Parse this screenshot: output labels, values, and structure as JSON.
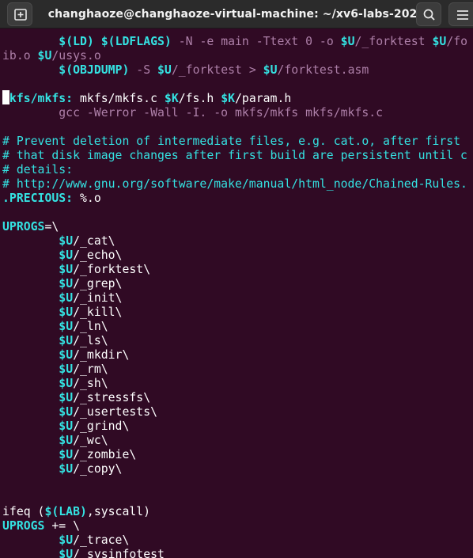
{
  "window": {
    "title": "changhaoze@changhaoze-virtual-machine: ~/xv6-labs-2020",
    "new_tab_icon": "new-tab-icon",
    "search_icon": "search-icon",
    "menu_icon": "hamburger-menu-icon"
  },
  "colors": {
    "terminal_bg": "#300a24",
    "titlebar_bg": "#2b2b2b",
    "cyan": "#34e2e2",
    "recipe": "#ad7fa8",
    "plain": "#ffffff"
  },
  "lines": [
    [
      {
        "t": "        ",
        "k": "p"
      },
      {
        "t": "$(LD)",
        "k": "v"
      },
      {
        "t": " ",
        "k": "p"
      },
      {
        "t": "$(LDFLAGS)",
        "k": "v"
      },
      {
        "t": " -N -e main -Ttext 0 -o ",
        "k": "r"
      },
      {
        "t": "$U",
        "k": "v"
      },
      {
        "t": "/_forktest ",
        "k": "r"
      },
      {
        "t": "$U",
        "k": "v"
      },
      {
        "t": "/fo",
        "k": "r"
      }
    ],
    [
      {
        "t": "ib.o ",
        "k": "r"
      },
      {
        "t": "$U",
        "k": "v"
      },
      {
        "t": "/usys.o",
        "k": "r"
      }
    ],
    [
      {
        "t": "        ",
        "k": "p"
      },
      {
        "t": "$(OBJDUMP)",
        "k": "v"
      },
      {
        "t": " -S ",
        "k": "r"
      },
      {
        "t": "$U",
        "k": "v"
      },
      {
        "t": "/_forktest > ",
        "k": "r"
      },
      {
        "t": "$U",
        "k": "v"
      },
      {
        "t": "/forktest.asm",
        "k": "r"
      }
    ],
    [],
    [
      {
        "t": "mkfs/mkfs:",
        "k": "tg"
      },
      {
        "t": " mkfs/mkfs.c ",
        "k": "p"
      },
      {
        "t": "$K",
        "k": "v"
      },
      {
        "t": "/fs.h ",
        "k": "p"
      },
      {
        "t": "$K",
        "k": "v"
      },
      {
        "t": "/param.h",
        "k": "p"
      }
    ],
    [
      {
        "t": "        gcc -Werror -Wall -I. -o mkfs/mkfs mkfs/mkfs.c",
        "k": "r"
      }
    ],
    [],
    [
      {
        "t": "# Prevent deletion of intermediate files, e.g. cat.o, after first",
        "k": "c"
      }
    ],
    [
      {
        "t": "# that disk image changes after first build are persistent until c",
        "k": "c"
      }
    ],
    [
      {
        "t": "# details:",
        "k": "c"
      }
    ],
    [
      {
        "t": "# http://www.gnu.org/software/make/manual/html_node/Chained-Rules.",
        "k": "c"
      }
    ],
    [
      {
        "t": ".PRECIOUS:",
        "k": "tg"
      },
      {
        "t": " %.o",
        "k": "p"
      }
    ],
    [],
    [
      {
        "t": "UPROGS",
        "k": "tg"
      },
      {
        "t": "=\\",
        "k": "p"
      }
    ],
    [
      {
        "t": "        ",
        "k": "p"
      },
      {
        "t": "$U",
        "k": "v"
      },
      {
        "t": "/_cat\\",
        "k": "p"
      }
    ],
    [
      {
        "t": "        ",
        "k": "p"
      },
      {
        "t": "$U",
        "k": "v"
      },
      {
        "t": "/_echo\\",
        "k": "p"
      }
    ],
    [
      {
        "t": "        ",
        "k": "p"
      },
      {
        "t": "$U",
        "k": "v"
      },
      {
        "t": "/_forktest\\",
        "k": "p"
      }
    ],
    [
      {
        "t": "        ",
        "k": "p"
      },
      {
        "t": "$U",
        "k": "v"
      },
      {
        "t": "/_grep\\",
        "k": "p"
      }
    ],
    [
      {
        "t": "        ",
        "k": "p"
      },
      {
        "t": "$U",
        "k": "v"
      },
      {
        "t": "/_init\\",
        "k": "p"
      }
    ],
    [
      {
        "t": "        ",
        "k": "p"
      },
      {
        "t": "$U",
        "k": "v"
      },
      {
        "t": "/_kill\\",
        "k": "p"
      }
    ],
    [
      {
        "t": "        ",
        "k": "p"
      },
      {
        "t": "$U",
        "k": "v"
      },
      {
        "t": "/_ln\\",
        "k": "p"
      }
    ],
    [
      {
        "t": "        ",
        "k": "p"
      },
      {
        "t": "$U",
        "k": "v"
      },
      {
        "t": "/_ls\\",
        "k": "p"
      }
    ],
    [
      {
        "t": "        ",
        "k": "p"
      },
      {
        "t": "$U",
        "k": "v"
      },
      {
        "t": "/_mkdir\\",
        "k": "p"
      }
    ],
    [
      {
        "t": "        ",
        "k": "p"
      },
      {
        "t": "$U",
        "k": "v"
      },
      {
        "t": "/_rm\\",
        "k": "p"
      }
    ],
    [
      {
        "t": "        ",
        "k": "p"
      },
      {
        "t": "$U",
        "k": "v"
      },
      {
        "t": "/_sh\\",
        "k": "p"
      }
    ],
    [
      {
        "t": "        ",
        "k": "p"
      },
      {
        "t": "$U",
        "k": "v"
      },
      {
        "t": "/_stressfs\\",
        "k": "p"
      }
    ],
    [
      {
        "t": "        ",
        "k": "p"
      },
      {
        "t": "$U",
        "k": "v"
      },
      {
        "t": "/_usertests\\",
        "k": "p"
      }
    ],
    [
      {
        "t": "        ",
        "k": "p"
      },
      {
        "t": "$U",
        "k": "v"
      },
      {
        "t": "/_grind\\",
        "k": "p"
      }
    ],
    [
      {
        "t": "        ",
        "k": "p"
      },
      {
        "t": "$U",
        "k": "v"
      },
      {
        "t": "/_wc\\",
        "k": "p"
      }
    ],
    [
      {
        "t": "        ",
        "k": "p"
      },
      {
        "t": "$U",
        "k": "v"
      },
      {
        "t": "/_zombie\\",
        "k": "p"
      }
    ],
    [
      {
        "t": "        ",
        "k": "p"
      },
      {
        "t": "$U",
        "k": "v"
      },
      {
        "t": "/_copy\\",
        "k": "p"
      }
    ],
    [],
    [],
    [
      {
        "t": "ifeq (",
        "k": "p"
      },
      {
        "t": "$(LAB)",
        "k": "v"
      },
      {
        "t": ",syscall)",
        "k": "p"
      }
    ],
    [
      {
        "t": "UPROGS",
        "k": "tg"
      },
      {
        "t": " += \\",
        "k": "p"
      }
    ],
    [
      {
        "t": "        ",
        "k": "p"
      },
      {
        "t": "$U",
        "k": "v"
      },
      {
        "t": "/_trace\\",
        "k": "p"
      }
    ],
    [
      {
        "t": "        ",
        "k": "p"
      },
      {
        "t": "$U",
        "k": "v"
      },
      {
        "t": "/_sysinfotest",
        "k": "p"
      }
    ]
  ]
}
